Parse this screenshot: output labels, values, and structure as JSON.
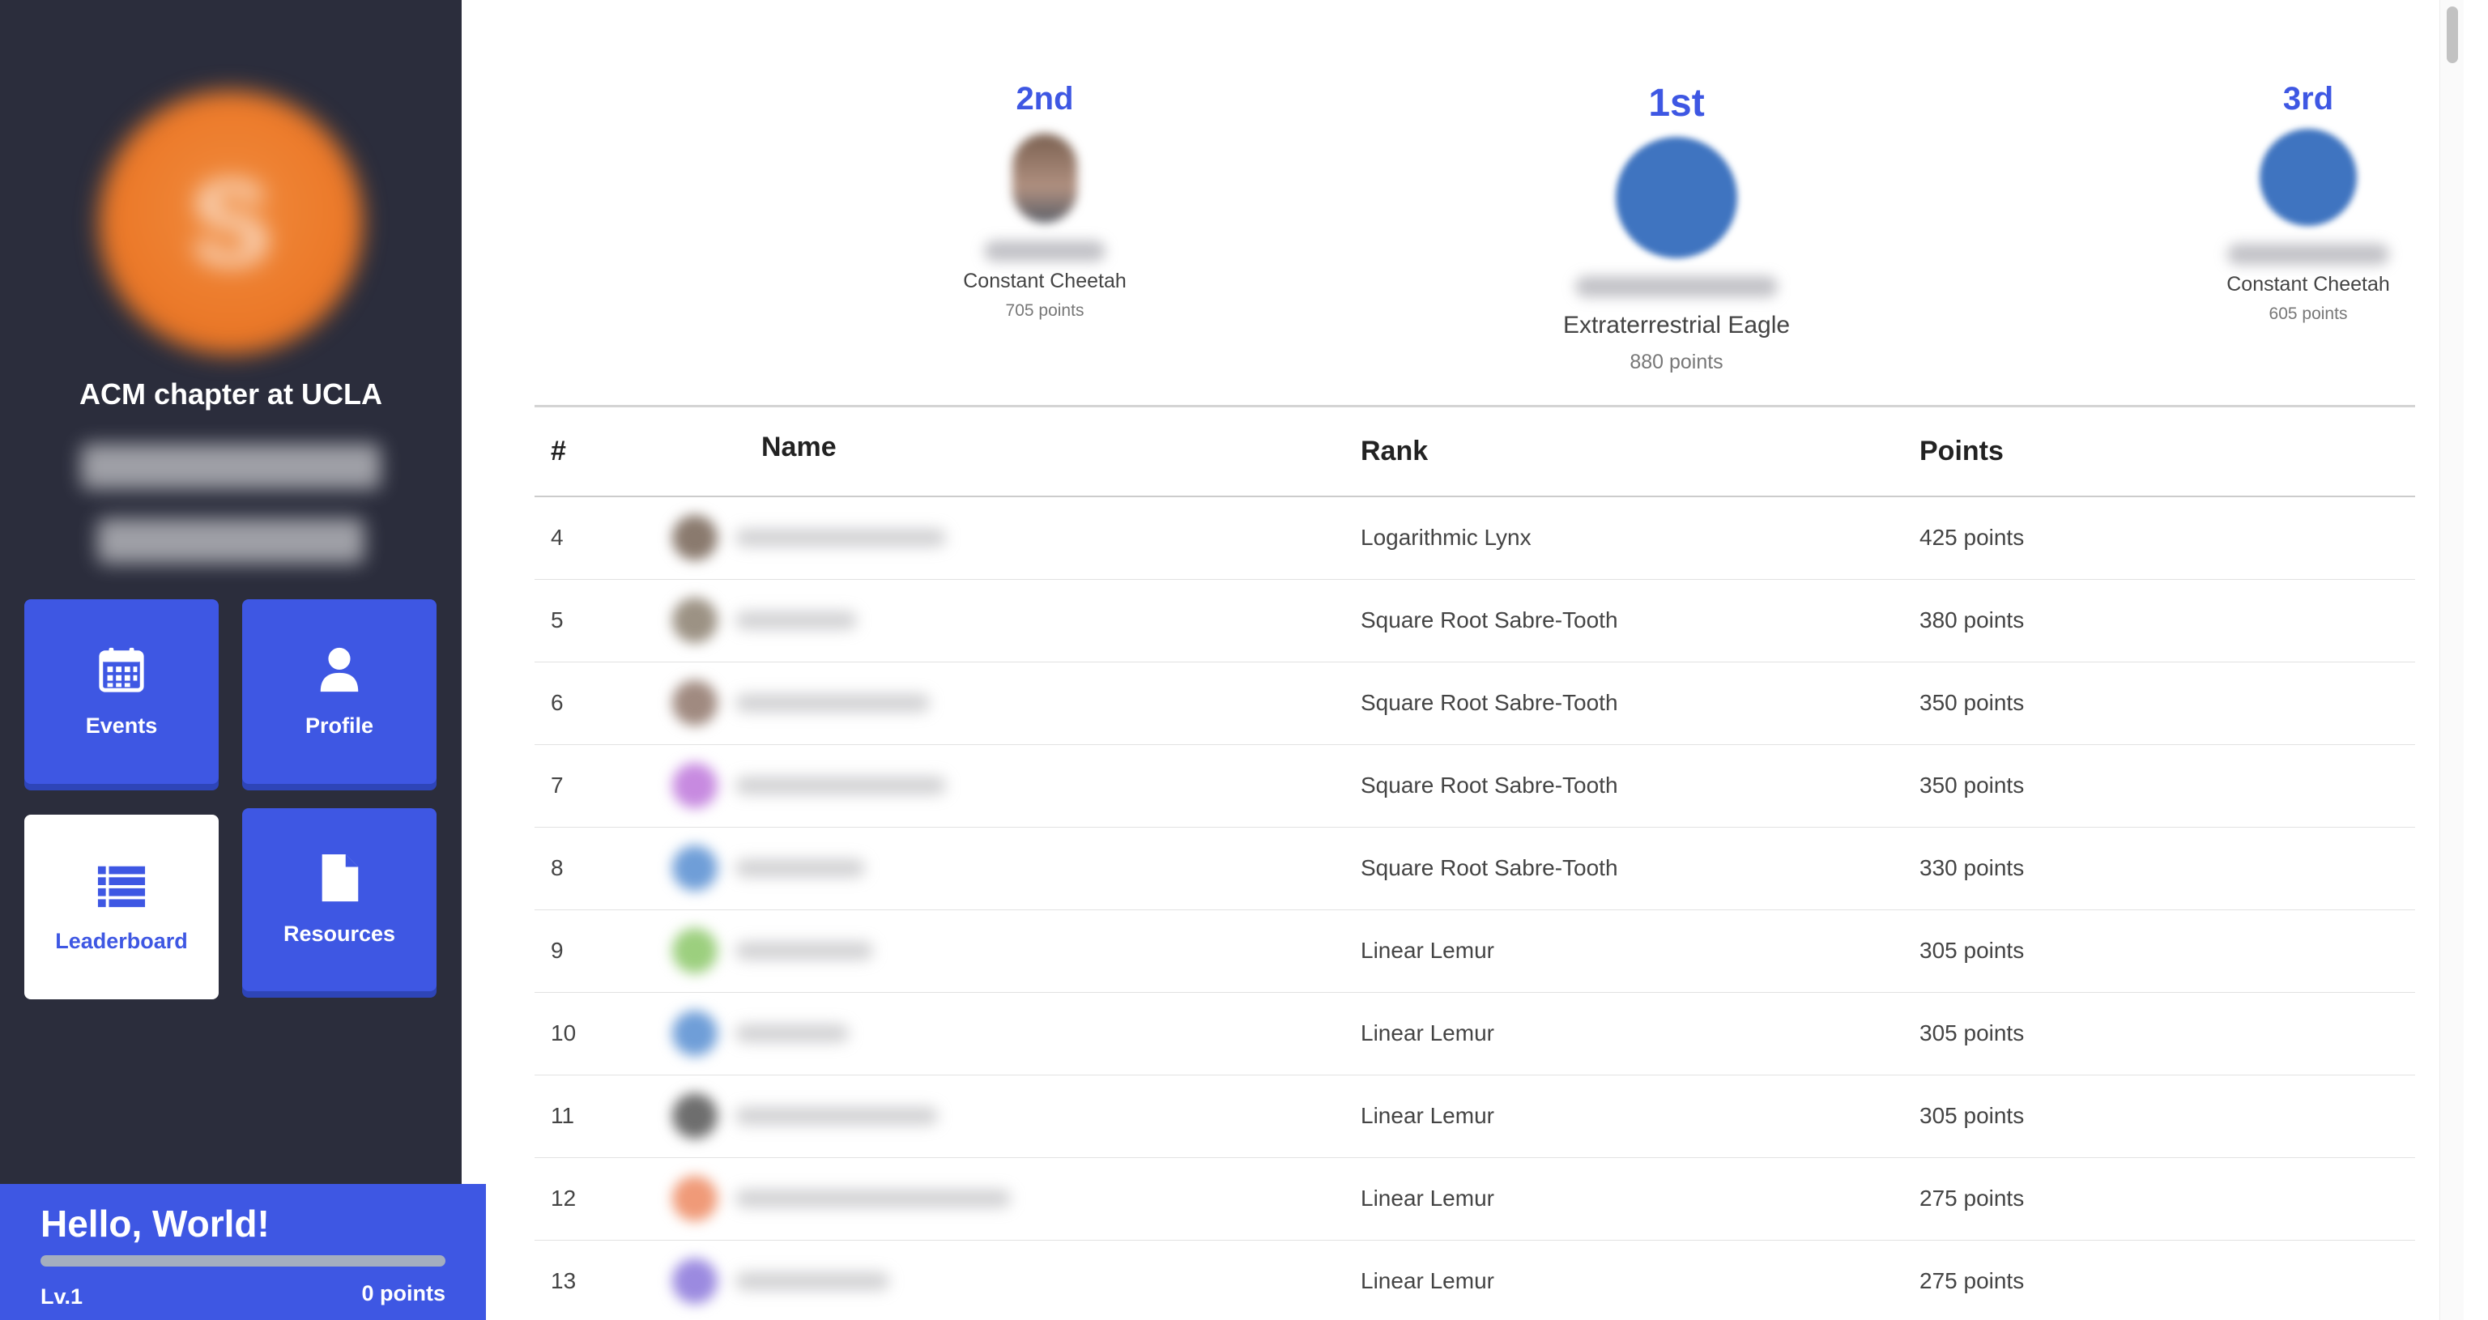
{
  "sidebar": {
    "org_name": "ACM chapter at UCLA",
    "avatar_letter": "S",
    "tiles": {
      "events": "Events",
      "profile": "Profile",
      "leaderboard": "Leaderboard",
      "resources": "Resources"
    },
    "icons": {
      "events": "calendar-icon",
      "profile": "user-icon",
      "leaderboard": "list-icon",
      "resources": "file-icon"
    },
    "footer": {
      "greeting": "Hello, World!",
      "level": "Lv.1",
      "points": "0 points",
      "progress_fraction": 0
    }
  },
  "podium": {
    "second": {
      "place": "2nd",
      "rank": "Constant Cheetah",
      "points": "705 points"
    },
    "first": {
      "place": "1st",
      "rank": "Extraterrestrial Eagle",
      "points": "880 points"
    },
    "third": {
      "place": "3rd",
      "rank": "Constant Cheetah",
      "points": "605 points"
    }
  },
  "table": {
    "headers": {
      "num": "#",
      "name": "Name",
      "rank": "Rank",
      "points": "Points"
    },
    "rows": [
      {
        "num": "4",
        "rank": "Logarithmic Lynx",
        "points": "425 points",
        "avatar_color": "#8a7a6e"
      },
      {
        "num": "5",
        "rank": "Square Root Sabre-Tooth",
        "points": "380 points",
        "avatar_color": "#9c9284"
      },
      {
        "num": "6",
        "rank": "Square Root Sabre-Tooth",
        "points": "350 points",
        "avatar_color": "#a08a80"
      },
      {
        "num": "7",
        "rank": "Square Root Sabre-Tooth",
        "points": "350 points",
        "avatar_color": "#c78ae0"
      },
      {
        "num": "8",
        "rank": "Square Root Sabre-Tooth",
        "points": "330 points",
        "avatar_color": "#6f9ed8"
      },
      {
        "num": "9",
        "rank": "Linear Lemur",
        "points": "305 points",
        "avatar_color": "#9ccf7e"
      },
      {
        "num": "10",
        "rank": "Linear Lemur",
        "points": "305 points",
        "avatar_color": "#6f9ed8"
      },
      {
        "num": "11",
        "rank": "Linear Lemur",
        "points": "305 points",
        "avatar_color": "#6e6e6e"
      },
      {
        "num": "12",
        "rank": "Linear Lemur",
        "points": "275 points",
        "avatar_color": "#f09a78"
      },
      {
        "num": "13",
        "rank": "Linear Lemur",
        "points": "275 points",
        "avatar_color": "#9b8ae0"
      }
    ]
  }
}
